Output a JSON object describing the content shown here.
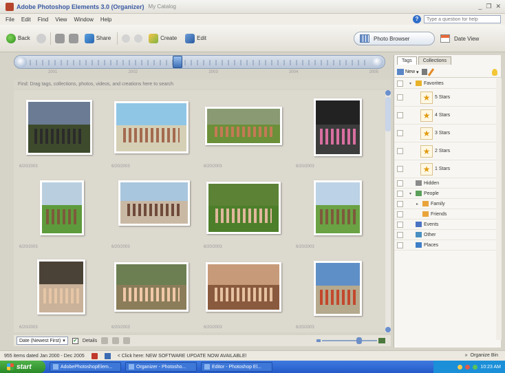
{
  "window": {
    "title": "Adobe Photoshop Elements 3.0 (Organizer)",
    "catalog": "My Catalog",
    "controls": [
      "_",
      "❐",
      "✕"
    ]
  },
  "menu": [
    "File",
    "Edit",
    "Find",
    "View",
    "Window",
    "Help"
  ],
  "help": {
    "placeholder": "Type a question for help"
  },
  "toolbar": {
    "back": "Back",
    "share": "Share",
    "create": "Create",
    "edit": "Edit",
    "photo_browser": "Photo Browser",
    "date_view": "Date View"
  },
  "timeline": {
    "ticks": [
      "2001",
      "2002",
      "2003",
      "2004",
      "2005"
    ]
  },
  "search_hint": "Find: Drag tags, collections, photos, videos, and creations here to search",
  "photos": [
    {
      "date": "6/20/2003",
      "sky": "#6a7b93",
      "ground": "#3e4a2c",
      "figs": "#2b2b2b"
    },
    {
      "date": "6/20/2003",
      "sky": "#8fc6e6",
      "ground": "#d5cfb6",
      "figs": "#a36a4f"
    },
    {
      "date": "6/20/2003",
      "sky": "#8a9b73",
      "ground": "#6c8f3a",
      "figs": "#c47a55"
    },
    {
      "date": "6/20/2003",
      "sky": "#222222",
      "ground": "#3c3c3c",
      "figs": "#d86fa0"
    },
    {
      "date": "6/20/2003",
      "sky": "#b9cfe0",
      "ground": "#5e9b3c",
      "figs": "#7d5b3b"
    },
    {
      "date": "6/20/2003",
      "sky": "#a8c6dd",
      "ground": "#c9b9a4",
      "figs": "#6f4a3a"
    },
    {
      "date": "6/20/2003",
      "sky": "#5b8235",
      "ground": "#4d7f2a",
      "figs": "#e0b89c"
    },
    {
      "date": "6/20/2003",
      "sky": "#bcd2e6",
      "ground": "#6aa244",
      "figs": "#7d5b3b"
    },
    {
      "date": "6/20/2003",
      "sky": "#4b4237",
      "ground": "#c9b299",
      "figs": "#e7c6a5"
    },
    {
      "date": "6/20/2003",
      "sky": "#6b7f52",
      "ground": "#8b7d5a",
      "figs": "#f0c8a8"
    },
    {
      "date": "6/20/2003",
      "sky": "#c79b7a",
      "ground": "#8a5a3e",
      "figs": "#e6c2a0"
    },
    {
      "date": "6/20/2003",
      "sky": "#5f8fc7",
      "ground": "#b5a98e",
      "figs": "#c2482c"
    }
  ],
  "gridbar": {
    "sort": "Date (Newest First)",
    "details": "Details"
  },
  "panel": {
    "tabs": [
      "Tags",
      "Collections"
    ],
    "new_label": "New",
    "tags": [
      {
        "kind": "category",
        "label": "Favorites",
        "color": "#e8b12a"
      },
      {
        "kind": "star",
        "label": "5 Stars"
      },
      {
        "kind": "star",
        "label": "4 Stars"
      },
      {
        "kind": "star",
        "label": "3 Stars"
      },
      {
        "kind": "star",
        "label": "2 Stars"
      },
      {
        "kind": "star",
        "label": "1 Stars"
      },
      {
        "kind": "category",
        "label": "Hidden",
        "color": "#8a8a8a"
      },
      {
        "kind": "category",
        "label": "People",
        "color": "#5ba05a"
      },
      {
        "kind": "sub",
        "label": "Family",
        "color": "#e9a53a"
      },
      {
        "kind": "sub",
        "label": "Friends",
        "color": "#e9a53a"
      },
      {
        "kind": "category",
        "label": "Events",
        "color": "#4a74c2"
      },
      {
        "kind": "category",
        "label": "Other",
        "color": "#4a8fc2"
      },
      {
        "kind": "category",
        "label": "Places",
        "color": "#3f7fc7"
      }
    ]
  },
  "status": {
    "items": "955 items dated Jan 2000 - Dec 2005",
    "update": "< Click here: NEW SOFTWARE UPDATE NOW AVAILABLE!",
    "organize": "Organize Bin"
  },
  "taskbar": {
    "start": "start",
    "tasks": [
      "AdobePhotoshopElem...",
      "Organizer - Photosho...",
      "Editor - Photoshop El..."
    ],
    "clock": "10:23 AM"
  }
}
